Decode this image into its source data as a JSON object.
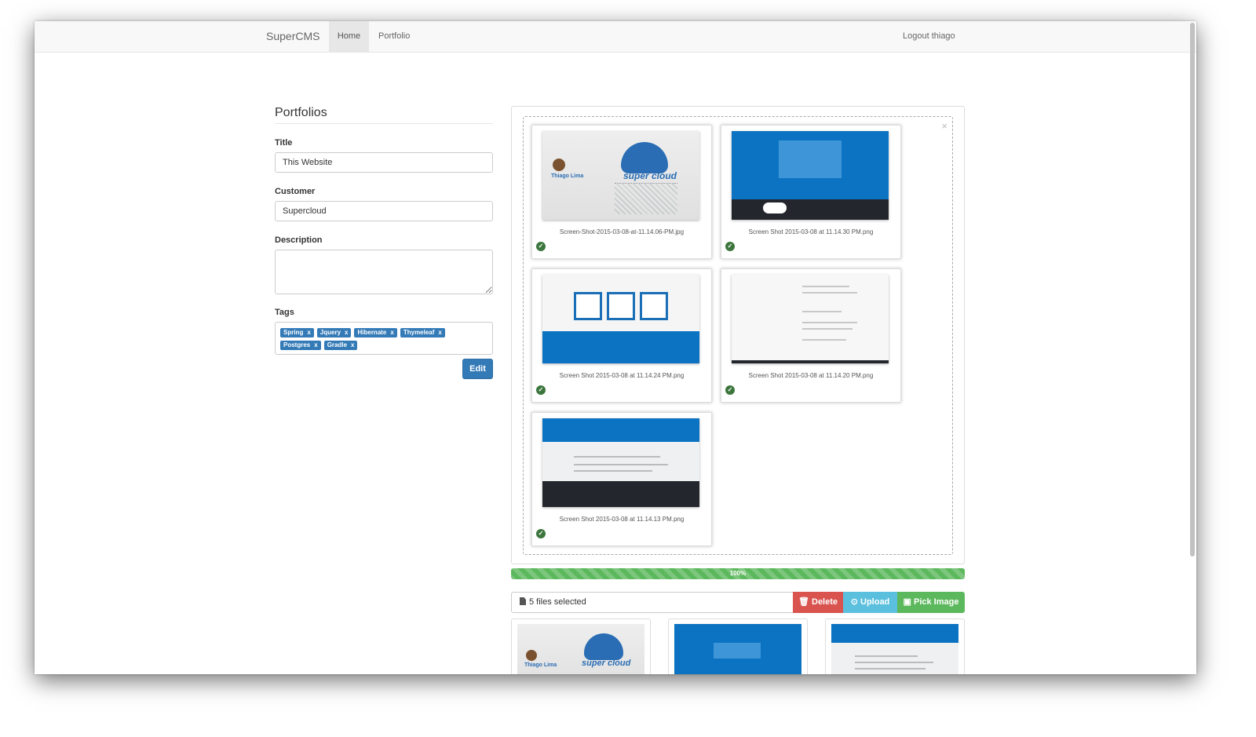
{
  "navbar": {
    "brand": "SuperCMS",
    "items": [
      {
        "label": "Home"
      },
      {
        "label": "Portfolio"
      }
    ],
    "logout": "Logout thiago"
  },
  "form": {
    "heading": "Portfolios",
    "title_label": "Title",
    "title_value": "This Website",
    "customer_label": "Customer",
    "customer_value": "Supercloud",
    "description_label": "Description",
    "description_value": "",
    "tags_label": "Tags",
    "tags": [
      {
        "label": "Spring",
        "remove": "x"
      },
      {
        "label": "Jquery",
        "remove": "x"
      },
      {
        "label": "Hibernate",
        "remove": "x"
      },
      {
        "label": "Thymeleaf",
        "remove": "x"
      },
      {
        "label": "Postgres",
        "remove": "x"
      },
      {
        "label": "Gradle",
        "remove": "x"
      }
    ],
    "edit_button": "Edit"
  },
  "dropzone": {
    "close": "×",
    "files": [
      {
        "name": "Screen-Shot-2015-03-08-at-11.14.06-PM.jpg",
        "status_icon": "check-circle-icon"
      },
      {
        "name": "Screen Shot 2015-03-08 at 11.14.30 PM.png",
        "status_icon": "check-circle-icon"
      },
      {
        "name": "Screen Shot 2015-03-08 at 11.14.24 PM.png",
        "status_icon": "check-circle-icon"
      },
      {
        "name": "Screen Shot 2015-03-08 at 11.14.20 PM.png",
        "status_icon": "check-circle-icon"
      },
      {
        "name": "Screen Shot 2015-03-08 at 11.14.13 PM.png",
        "status_icon": "check-circle-icon"
      }
    ],
    "thumb_texts": {
      "name": "Thiago Lima",
      "cloud": "super cloud"
    }
  },
  "progress": {
    "value": 100,
    "label": "100%"
  },
  "filebar": {
    "selected": "5 files selected",
    "delete": "Delete",
    "upload": "Upload",
    "pick": "Pick Image"
  },
  "colors": {
    "primary": "#337ab7",
    "danger": "#d9534f",
    "info": "#5bc0de",
    "success": "#5cb85c"
  }
}
